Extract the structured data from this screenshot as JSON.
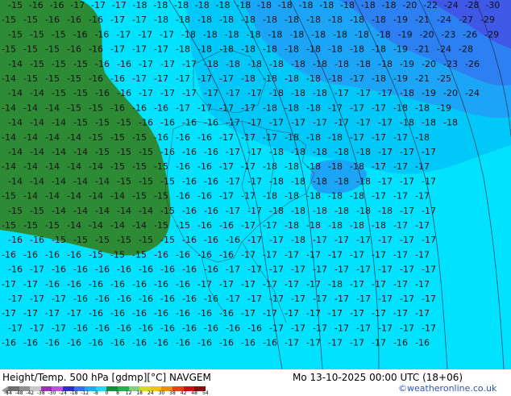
{
  "footer": {
    "title": "Height/Temp. 500 hPa [gdmp][°C] NAVGEM",
    "valid_time": "Mo 13-10-2025 00:00 UTC (18+06)",
    "credit": "©weatheronline.co.uk"
  },
  "colorbar": {
    "ticks": [
      "-54",
      "-48",
      "-42",
      "-38",
      "-30",
      "-24",
      "-18",
      "-12",
      "-8",
      "0",
      "8",
      "12",
      "18",
      "24",
      "30",
      "38",
      "42",
      "48",
      "54"
    ],
    "colors": [
      "#6d6d6d",
      "#8e8e8e",
      "#c8c8c8",
      "#9b31b5",
      "#c050e0",
      "#2c2cc8",
      "#3a6ef0",
      "#1eaaf0",
      "#22d8f5",
      "#0f8f3c",
      "#22b14c",
      "#7fd17f",
      "#d9d92b",
      "#f0c020",
      "#f08c10",
      "#e84010",
      "#c81010",
      "#8a0a0a"
    ]
  },
  "map": {
    "palette": {
      "green": "#2e8b35",
      "light_cyan": "#00e0ff",
      "cyan": "#00c8f8",
      "blue1": "#1aa0f4",
      "blue2": "#2b7cf0",
      "blue3": "#3f55e6"
    },
    "temperature_labels": [
      {
        "row": 0,
        "values": [
          "-15",
          "-16",
          "-16",
          "-17",
          "-17",
          "-17",
          "-18",
          "-18",
          "-18",
          "-18",
          "-18",
          "-18",
          "-18",
          "-18",
          "-18",
          "-18",
          "-18",
          "-18",
          "-18",
          "-20",
          "-22",
          "-24",
          "-28",
          "-30"
        ]
      },
      {
        "row": 1,
        "values": [
          "-15",
          "-15",
          "-16",
          "-16",
          "-16",
          "-17",
          "-17",
          "-18",
          "-18",
          "-18",
          "-18",
          "-18",
          "-18",
          "-18",
          "-18",
          "-18",
          "-18",
          "-18",
          "-19",
          "-21",
          "-24",
          "-27",
          "-29"
        ]
      },
      {
        "row": 2,
        "values": [
          "-15",
          "-15",
          "-15",
          "-16",
          "-16",
          "-17",
          "-17",
          "-17",
          "-18",
          "-18",
          "-18",
          "-18",
          "-18",
          "-18",
          "-18",
          "-18",
          "-18",
          "-18",
          "-19",
          "-20",
          "-23",
          "-26",
          "-29"
        ]
      },
      {
        "row": 3,
        "values": [
          "-15",
          "-15",
          "-15",
          "-16",
          "-16",
          "-17",
          "-17",
          "-17",
          "-18",
          "-18",
          "-18",
          "-18",
          "-18",
          "-18",
          "-18",
          "-18",
          "-18",
          "-18",
          "-19",
          "-21",
          "-24",
          "-28"
        ]
      },
      {
        "row": 4,
        "values": [
          "-14",
          "-15",
          "-15",
          "-15",
          "-16",
          "-16",
          "-17",
          "-17",
          "-17",
          "-18",
          "-18",
          "-18",
          "-18",
          "-18",
          "-18",
          "-18",
          "-18",
          "-18",
          "-19",
          "-20",
          "-23",
          "-26"
        ]
      },
      {
        "row": 5,
        "values": [
          "-14",
          "-15",
          "-15",
          "-15",
          "-16",
          "-16",
          "-17",
          "-17",
          "-17",
          "-17",
          "-17",
          "-18",
          "-18",
          "-18",
          "-18",
          "-18",
          "-17",
          "-18",
          "-19",
          "-21",
          "-25"
        ]
      },
      {
        "row": 6,
        "values": [
          "-14",
          "-14",
          "-15",
          "-15",
          "-16",
          "-16",
          "-17",
          "-17",
          "-17",
          "-17",
          "-17",
          "-17",
          "-18",
          "-18",
          "-18",
          "-17",
          "-17",
          "-17",
          "-18",
          "-19",
          "-20",
          "-24"
        ]
      },
      {
        "row": 7,
        "values": [
          "-14",
          "-14",
          "-14",
          "-15",
          "-15",
          "-16",
          "-16",
          "-16",
          "-17",
          "-17",
          "-17",
          "-17",
          "-18",
          "-18",
          "-18",
          "-17",
          "-17",
          "-17",
          "-18",
          "-18",
          "-19"
        ]
      },
      {
        "row": 8,
        "values": [
          "-14",
          "-14",
          "-14",
          "-15",
          "-15",
          "-15",
          "-16",
          "-16",
          "-16",
          "-16",
          "-17",
          "-17",
          "-17",
          "-17",
          "-17",
          "-17",
          "-17",
          "-17",
          "-18",
          "-18",
          "-18"
        ]
      },
      {
        "row": 9,
        "values": [
          "-14",
          "-14",
          "-14",
          "-14",
          "-15",
          "-15",
          "-15",
          "-16",
          "-16",
          "-16",
          "-17",
          "-17",
          "-17",
          "-18",
          "-18",
          "-18",
          "-17",
          "-17",
          "-17",
          "-18"
        ]
      },
      {
        "row": 10,
        "values": [
          "-14",
          "-14",
          "-14",
          "-14",
          "-15",
          "-15",
          "-15",
          "-16",
          "-16",
          "-16",
          "-17",
          "-17",
          "-18",
          "-18",
          "-18",
          "-18",
          "-18",
          "-17",
          "-17",
          "-17"
        ]
      },
      {
        "row": 11,
        "values": [
          "-14",
          "-14",
          "-14",
          "-14",
          "-14",
          "-15",
          "-15",
          "-15",
          "-16",
          "-16",
          "-17",
          "-17",
          "-18",
          "-18",
          "-18",
          "-18",
          "-18",
          "-17",
          "-17",
          "-17"
        ]
      },
      {
        "row": 12,
        "values": [
          "-14",
          "-14",
          "-14",
          "-14",
          "-14",
          "-15",
          "-15",
          "-15",
          "-16",
          "-16",
          "-17",
          "-17",
          "-18",
          "-18",
          "-18",
          "-18",
          "-18",
          "-17",
          "-17",
          "-17"
        ]
      },
      {
        "row": 13,
        "values": [
          "-15",
          "-14",
          "-14",
          "-14",
          "-14",
          "-14",
          "-15",
          "-15",
          "-16",
          "-16",
          "-17",
          "-17",
          "-18",
          "-18",
          "-18",
          "-18",
          "-18",
          "-17",
          "-17",
          "-17"
        ]
      },
      {
        "row": 14,
        "values": [
          "-15",
          "-15",
          "-14",
          "-14",
          "-14",
          "-14",
          "-14",
          "-15",
          "-16",
          "-16",
          "-17",
          "-17",
          "-18",
          "-18",
          "-18",
          "-18",
          "-18",
          "-18",
          "-17",
          "-17"
        ]
      },
      {
        "row": 15,
        "values": [
          "-15",
          "-15",
          "-15",
          "-14",
          "-14",
          "-14",
          "-14",
          "-15",
          "-15",
          "-16",
          "-16",
          "-17",
          "-17",
          "-18",
          "-18",
          "-18",
          "-18",
          "-18",
          "-17",
          "-17"
        ]
      },
      {
        "row": 16,
        "values": [
          "-16",
          "-16",
          "-15",
          "-15",
          "-15",
          "-15",
          "-15",
          "-15",
          "-16",
          "-16",
          "-16",
          "-17",
          "-17",
          "-18",
          "-17",
          "-17",
          "-17",
          "-17",
          "-17",
          "-17"
        ]
      },
      {
        "row": 17,
        "values": [
          "-16",
          "-16",
          "-16",
          "-16",
          "-15",
          "-15",
          "-15",
          "-16",
          "-16",
          "-16",
          "-16",
          "-17",
          "-17",
          "-17",
          "-17",
          "-17",
          "-17",
          "-17",
          "-17",
          "-17"
        ]
      },
      {
        "row": 18,
        "values": [
          "-16",
          "-17",
          "-16",
          "-16",
          "-16",
          "-16",
          "-16",
          "-16",
          "-16",
          "-16",
          "-17",
          "-17",
          "-17",
          "-17",
          "-17",
          "-17",
          "-17",
          "-17",
          "-17",
          "-17"
        ]
      },
      {
        "row": 19,
        "values": [
          "-17",
          "-17",
          "-16",
          "-16",
          "-16",
          "-16",
          "-16",
          "-16",
          "-16",
          "-17",
          "-17",
          "-17",
          "-17",
          "-17",
          "-17",
          "-18",
          "-17",
          "-17",
          "-17",
          "-17"
        ]
      },
      {
        "row": 20,
        "values": [
          "-17",
          "-17",
          "-17",
          "-16",
          "-16",
          "-16",
          "-16",
          "-16",
          "-16",
          "-16",
          "-17",
          "-17",
          "-17",
          "-17",
          "-17",
          "-17",
          "-17",
          "-17",
          "-17",
          "-17"
        ]
      },
      {
        "row": 21,
        "values": [
          "-17",
          "-17",
          "-17",
          "-17",
          "-16",
          "-16",
          "-16",
          "-16",
          "-16",
          "-16",
          "-16",
          "-17",
          "-17",
          "-17",
          "-17",
          "-17",
          "-17",
          "-17",
          "-17",
          "-17"
        ]
      },
      {
        "row": 22,
        "values": [
          "-17",
          "-17",
          "-17",
          "-16",
          "-16",
          "-16",
          "-16",
          "-16",
          "-16",
          "-16",
          "-16",
          "-16",
          "-17",
          "-17",
          "-17",
          "-17",
          "-17",
          "-17",
          "-17",
          "-17"
        ]
      },
      {
        "row": 23,
        "values": [
          "-16",
          "-16",
          "-16",
          "-16",
          "-16",
          "-16",
          "-16",
          "-16",
          "-16",
          "-16",
          "-16",
          "-16",
          "-16",
          "-17",
          "-17",
          "-17",
          "-17",
          "-17",
          "-16",
          "-16"
        ]
      }
    ]
  }
}
